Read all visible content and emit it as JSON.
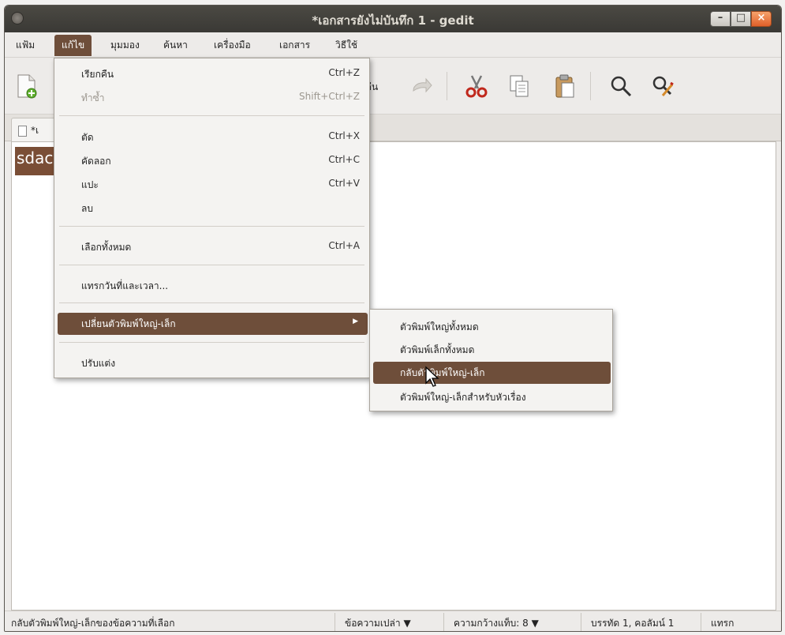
{
  "window": {
    "title": "*เอกสารยังไม่บันทึก 1 - gedit"
  },
  "window_buttons": {
    "minimize": "–",
    "maximize": "□",
    "close": "×"
  },
  "menubar": {
    "items": [
      {
        "label": "แฟ้ม"
      },
      {
        "label": "แก้ไข"
      },
      {
        "label": "มุมมอง"
      },
      {
        "label": "ค้นหา"
      },
      {
        "label": "เครื่องมือ"
      },
      {
        "label": "เอกสาร"
      },
      {
        "label": "วิธีใช้"
      }
    ]
  },
  "toolbar": {
    "redo_partial_label": "คืน"
  },
  "tab": {
    "label": "*เ"
  },
  "editor": {
    "selected_text": "sdac"
  },
  "edit_menu": {
    "items": [
      {
        "label": "เรียกคืน",
        "accel": "Ctrl+Z"
      },
      {
        "label": "ทำซ้ำ",
        "accel": "Shift+Ctrl+Z"
      },
      {
        "label": "ตัด",
        "accel": "Ctrl+X"
      },
      {
        "label": "คัดลอก",
        "accel": "Ctrl+C"
      },
      {
        "label": "แปะ",
        "accel": "Ctrl+V"
      },
      {
        "label": "ลบ",
        "accel": ""
      },
      {
        "label": "เลือกทั้งหมด",
        "accel": "Ctrl+A"
      },
      {
        "label": "แทรกวันที่และเวลา...",
        "accel": ""
      },
      {
        "label": "เปลี่ยนตัวพิมพ์ใหญ่-เล็ก",
        "accel": ""
      },
      {
        "label": "ปรับแต่ง",
        "accel": ""
      }
    ]
  },
  "case_submenu": {
    "items": [
      {
        "label": "ตัวพิมพ์ใหญ่ทั้งหมด"
      },
      {
        "label": "ตัวพิมพ์เล็กทั้งหมด"
      },
      {
        "label": "กลับตัวพิมพ์ใหญ่-เล็ก"
      },
      {
        "label": "ตัวพิมพ์ใหญ่-เล็กสำหรับหัวเรื่อง"
      }
    ]
  },
  "statusbar": {
    "message": "กลับตัวพิมพ์ใหญ่-เล็กของข้อความที่เลือก",
    "highlight_mode": "ข้อความเปล่า ▼",
    "tab_width": "ความกว้างแท็บ:  8  ▼",
    "position": "บรรทัด 1, คอลัมน์ 1",
    "insert_mode": "แทรก"
  },
  "colors": {
    "accent": "#6e4e3a",
    "titlebar": "#3c3b37",
    "close_button": "#e0602a"
  }
}
